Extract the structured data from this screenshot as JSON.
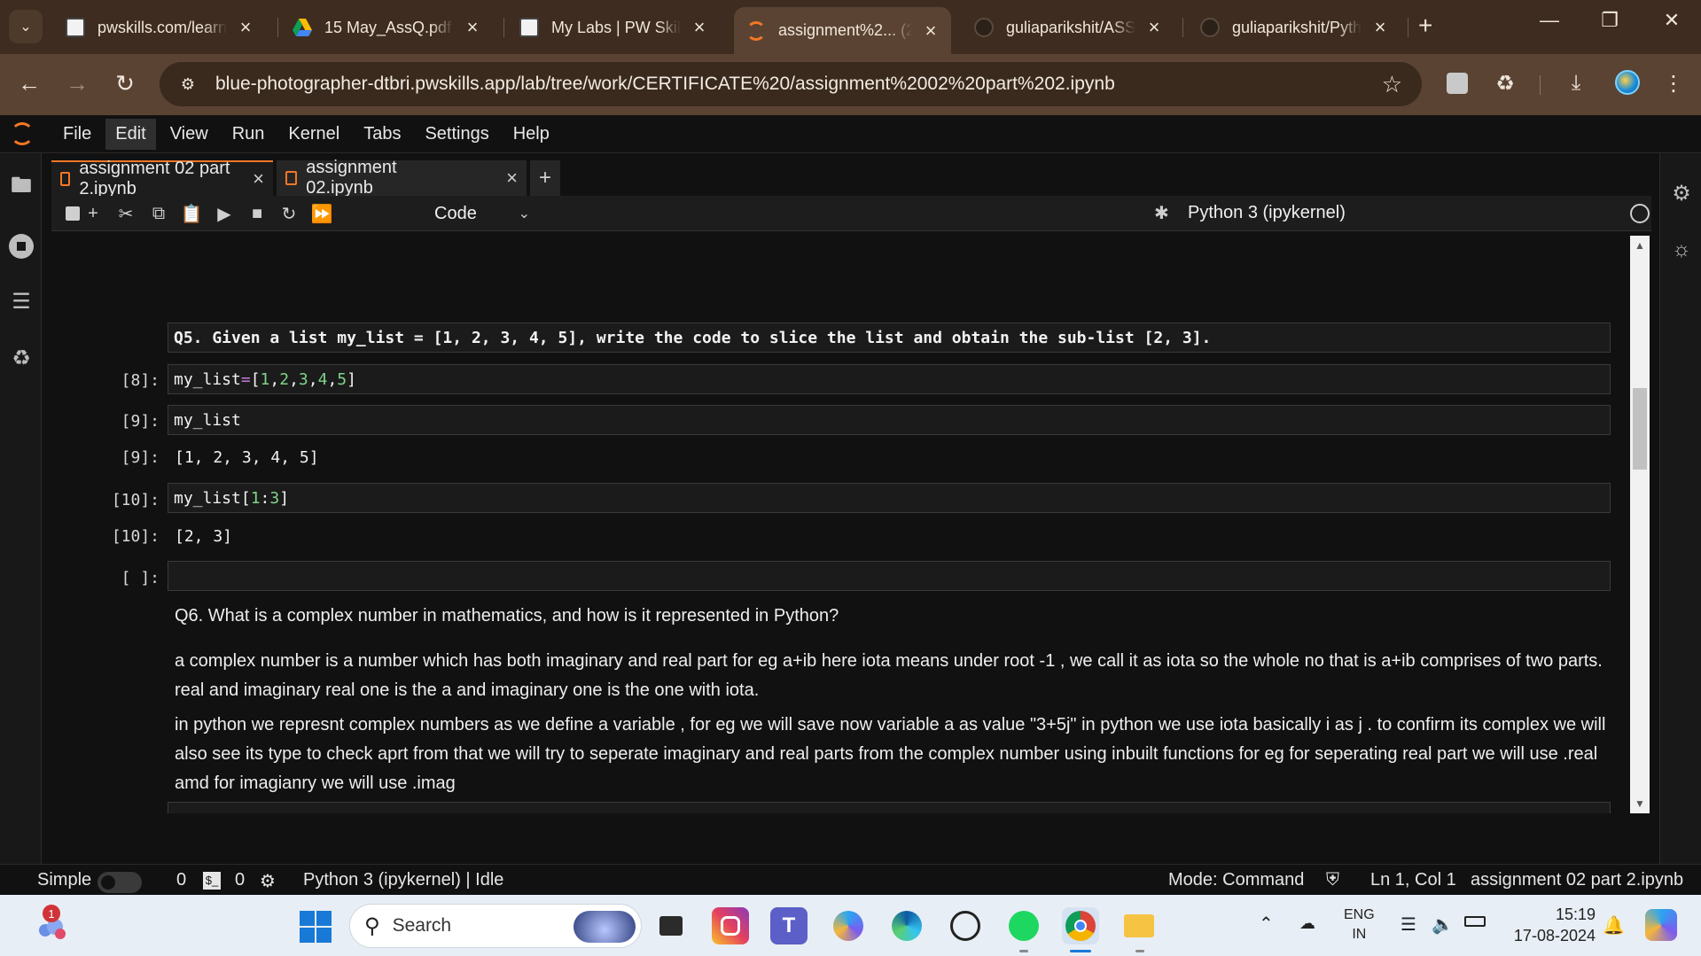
{
  "browser": {
    "tabs": [
      {
        "title": "pwskills.com/learn",
        "favicon": "pwskills-icon"
      },
      {
        "title": "15 May_AssQ.pdf",
        "favicon": "google-drive-icon"
      },
      {
        "title": "My Labs | PW Skills",
        "favicon": "pwskills-icon"
      },
      {
        "title": "assignment%2... (2",
        "favicon": "jupyter-icon",
        "active": true
      },
      {
        "title": "guliaparikshit/ASSI",
        "favicon": "github-icon"
      },
      {
        "title": "guliaparikshit/Pyth",
        "favicon": "github-icon"
      }
    ],
    "url": "blue-photographer-dtbri.pwskills.app/lab/tree/work/CERTIFICATE%20/assignment%2002%20part%202.ipynb"
  },
  "jupyter": {
    "menu": [
      "File",
      "Edit",
      "View",
      "Run",
      "Kernel",
      "Tabs",
      "Settings",
      "Help"
    ],
    "active_menu": "Edit",
    "doc_tabs": [
      {
        "title": "assignment 02 part 2.ipynb",
        "active": true
      },
      {
        "title": "assignment 02.ipynb",
        "active": false
      }
    ],
    "cell_type": "Code",
    "kernel": "Python 3 (ipykernel)",
    "cells": {
      "q5_heading": "Q5. Given a list my_list = [1, 2, 3, 4, 5], write the code to slice the list and obtain the sub-list [2, 3].",
      "c8_prompt": "[8]:",
      "c9_prompt": "[9]:",
      "c9_input": "my_list",
      "c9_out_prompt": "[9]:",
      "c9_output": "[1, 2, 3, 4, 5]",
      "c10_prompt": "[10]:",
      "c10_out_prompt": "[10]:",
      "c10_output": "[2, 3]",
      "empty_prompt": "[ ]:",
      "q6_heading": "Q6. What is a complex number in mathematics, and how is it represented in Python?",
      "q6_para1": "a complex number is a number which has both imaginary and real part for eg a+ib here iota means under root -1 , we call it as iota so the whole no that is a+ib comprises of two parts. real and imaginary real one is the a and imaginary one is the one with iota.",
      "q6_para2": "in python we represnt complex numbers as we define a variable , for eg we will save now variable a as value \"3+5j\" in python we use iota basically i as j . to confirm its complex we will also see its type to check aprt from that we will try to seperate imaginary and real parts from the complex number using inbuilt functions for eg for seperating real part we will use .real amd for imagianry we will use .imag"
    },
    "status": {
      "mode_label": "Simple",
      "count_a": "0",
      "count_b": "0",
      "kernel_state": "Python 3 (ipykernel) | Idle",
      "mode": "Mode: Command",
      "cursor": "Ln 1, Col 1",
      "filename": "assignment 02 part 2.ipynb"
    }
  },
  "taskbar": {
    "search_placeholder": "Search",
    "notification_count": "1",
    "language": "ENG",
    "region": "IN",
    "time": "15:19",
    "date": "17-08-2024",
    "accent": "#1979d6"
  }
}
